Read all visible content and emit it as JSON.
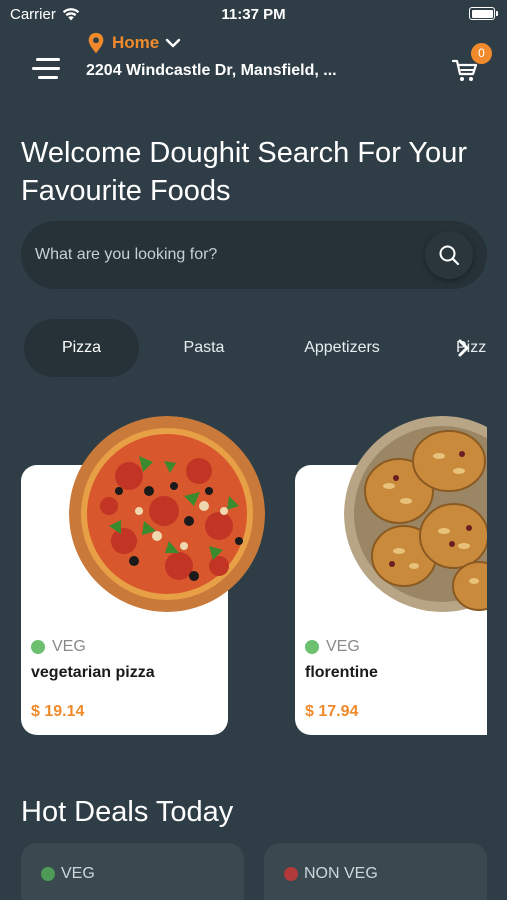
{
  "status_bar": {
    "carrier": "Carrier",
    "time": "11:37 PM"
  },
  "header": {
    "location_label": "Home",
    "address": "2204 Windcastle Dr, Mansfield, ...",
    "cart_count": "0",
    "accent_color": "#f08a2c"
  },
  "welcome": {
    "line1": "Welcome Doughit Search For Your",
    "line2": "Favourite Foods"
  },
  "search": {
    "placeholder": "What are you looking for?"
  },
  "categories": [
    {
      "label": "Pizza",
      "active": true
    },
    {
      "label": "Pasta",
      "active": false
    },
    {
      "label": "Appetizers",
      "active": false
    },
    {
      "label": "Pizz",
      "active": false
    }
  ],
  "products": [
    {
      "type": "VEG",
      "name": "vegetarian pizza",
      "price": "$ 19.14",
      "dot_color": "#6cc070"
    },
    {
      "type": "VEG",
      "name": "florentine",
      "price": "$ 17.94",
      "dot_color": "#6cc070"
    }
  ],
  "hot_deals": {
    "title": "Hot Deals Today",
    "items": [
      {
        "type": "VEG",
        "dot_color": "#4f9a56"
      },
      {
        "type": "NON VEG",
        "dot_color": "#b13a3a"
      }
    ]
  }
}
